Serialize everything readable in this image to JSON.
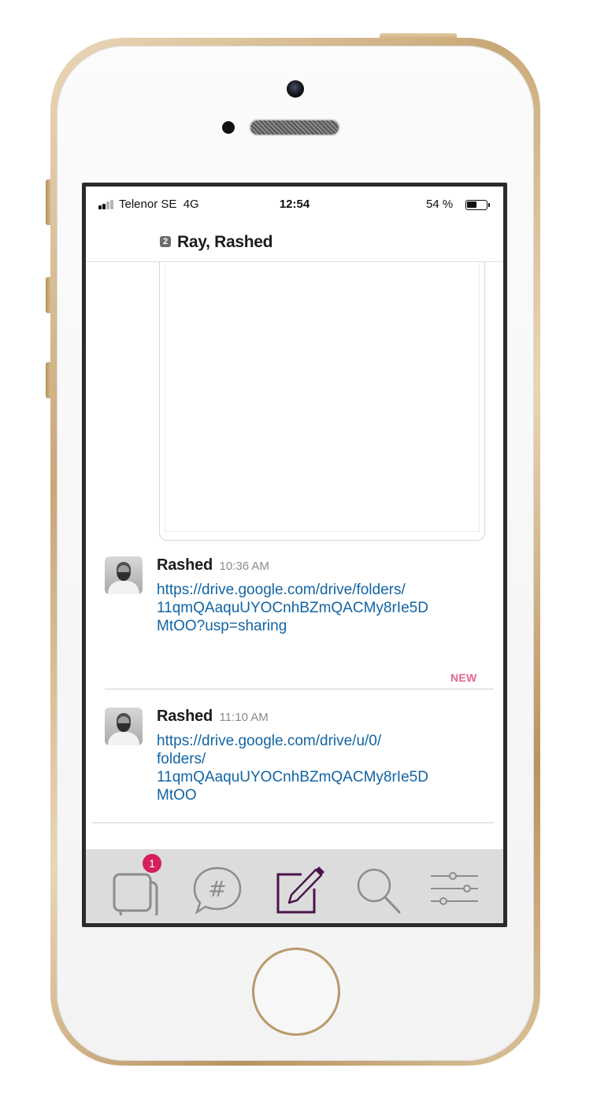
{
  "status_bar": {
    "carrier": "Telenor SE",
    "network": "4G",
    "time": "12:54",
    "battery_percent": "54 %",
    "battery_level": 0.54
  },
  "header": {
    "member_count": "2",
    "title": "Ray, Rashed"
  },
  "messages": [
    {
      "author": "Rashed",
      "time": "10:36 AM",
      "link": "https://drive.google.com/drive/folders/11qmQAaquUYOCnhBZmQACMy8rIe5DMtOO?usp=sharing"
    },
    {
      "author": "Rashed",
      "time": "11:10 AM",
      "link": "https://drive.google.com/drive/u/0/folders/11qmQAaquUYOCnhBZmQACMy8rIe5DMtOO"
    }
  ],
  "new_marker": "NEW",
  "tab_bar": {
    "items": [
      {
        "icon": "conversations-icon",
        "badge": "1"
      },
      {
        "icon": "channel-hash-icon"
      },
      {
        "icon": "compose-icon"
      },
      {
        "icon": "search-icon"
      },
      {
        "icon": "settings-sliders-icon"
      }
    ],
    "icon_color": "#8c8c8c",
    "active_color": "#4a154b",
    "badge_color": "#d4205c"
  },
  "colors": {
    "link": "#1264a3",
    "new_marker": "#e0678c",
    "tab_bar_bg": "#dcdcdc"
  }
}
